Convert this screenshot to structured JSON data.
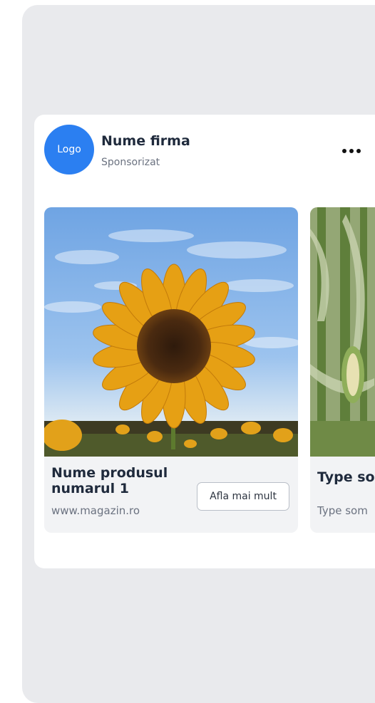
{
  "ad": {
    "logo_label": "Logo",
    "brand_name": "Nume firma",
    "sponsored_label": "Sponsorizat",
    "more_icon": "more-horizontal-icon"
  },
  "carousel": [
    {
      "title": "Nume produsul numarul 1",
      "url": "www.magazin.ro",
      "cta_label": "Afla mai mult",
      "image": "sunflower-photo"
    },
    {
      "title": "Type so",
      "subtitle": "Type som",
      "image": "corn-field-photo"
    }
  ],
  "colors": {
    "brand_blue": "#2b7ff1",
    "background": "#e9eaed",
    "card_bg": "#f2f3f5",
    "text_dark": "#1f2a3c"
  }
}
